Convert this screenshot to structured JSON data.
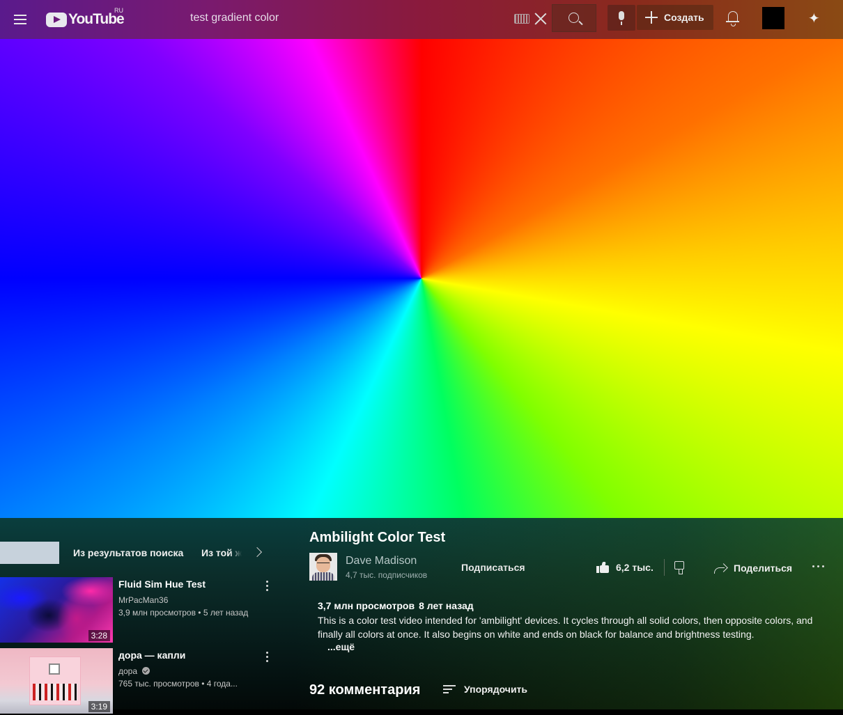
{
  "header": {
    "logo_text": "YouTube",
    "region": "RU",
    "search_value": "test gradient color",
    "create_label": "Создать"
  },
  "player": {
    "content": "color-wheel-gradient"
  },
  "sidebar": {
    "chips": [
      "Из результатов поиска",
      "Из той же серии"
    ],
    "recommendations": [
      {
        "title": "Fluid Sim Hue Test",
        "channel": "MrPacMan36",
        "views": "3,9 млн просмотров",
        "age": "5 лет назад",
        "duration": "3:28"
      },
      {
        "title": "дора — капли",
        "channel": "дора",
        "verified": true,
        "views": "765 тыс. просмотров",
        "age": "4 года...",
        "duration": "3:19"
      }
    ]
  },
  "video": {
    "title": "Ambilight Color Test",
    "channel_name": "Dave Madison",
    "subscribers": "4,7 тыс. подписчиков",
    "subscribe_label": "Подписаться",
    "likes": "6,2 тыс.",
    "share_label": "Поделиться",
    "views": "3,7 млн просмотров",
    "published": "8 лет назад",
    "description": "This is a color test video intended for 'ambilight' devices. It cycles through all solid colors, then opposite colors, and finally all colors at once. It also begins on white and ends on black for balance and brightness testing.",
    "more_label": "...ещё"
  },
  "comments": {
    "count_label": "92 комментария",
    "sort_label": "Упорядочить"
  },
  "colors": {
    "chip_active": "#c7d2dc",
    "topbar_left": "#5a1a8c",
    "topbar_right": "#8a4a14"
  }
}
